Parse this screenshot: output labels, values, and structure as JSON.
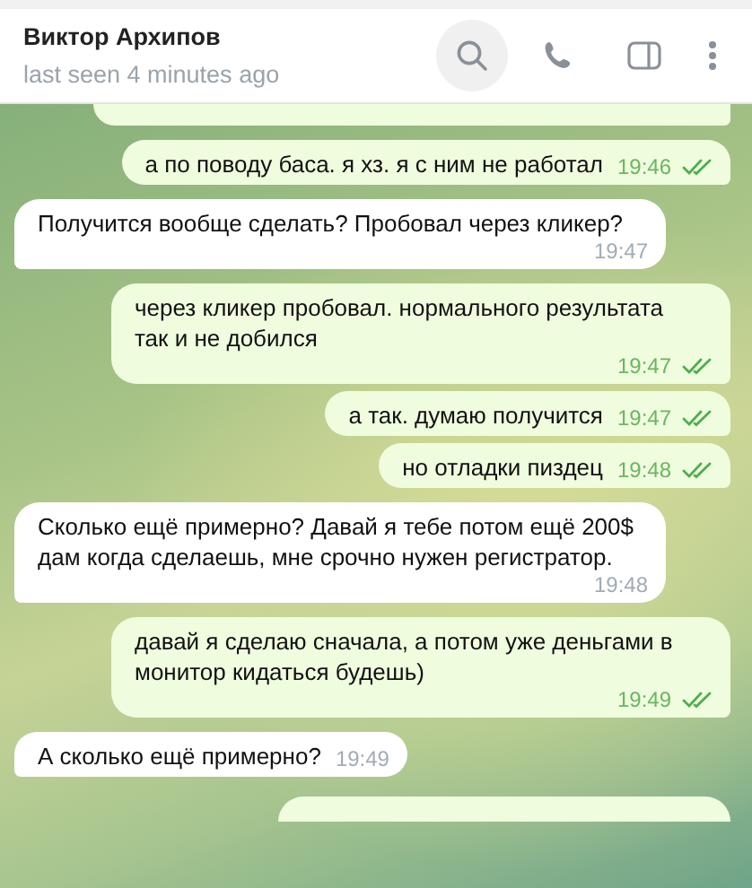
{
  "header": {
    "name": "Виктор Архипов",
    "status": "last seen 4 minutes ago",
    "search_active": true
  },
  "messages": [
    {
      "kind": "out_cut_top"
    },
    {
      "kind": "out",
      "text": "а по поводу баса. я хз. я с ним не работал",
      "time": "19:46",
      "read": true
    },
    {
      "kind": "in",
      "text": "Получится вообще сделать? Пробовал через кликер?",
      "time": "19:47"
    },
    {
      "kind": "out",
      "text": "через кликер пробовал. нормального результата так и не добился",
      "time": "19:47",
      "read": true
    },
    {
      "kind": "out",
      "text": "а так. думаю получится",
      "time": "19:47",
      "read": true
    },
    {
      "kind": "out",
      "text": "но отладки пиздец",
      "time": "19:48",
      "read": true
    },
    {
      "kind": "in",
      "text": "Сколько ещё примерно? Давай я тебе потом ещё 200$ дам когда сделаешь, мне срочно нужен регистратор.",
      "time": "19:48"
    },
    {
      "kind": "out",
      "text": "давай я сделаю сначала, а потом уже деньгами в монитор кидаться будешь)",
      "time": "19:49",
      "read": true
    },
    {
      "kind": "in",
      "text": "А сколько ещё примерно?",
      "time": "19:49"
    },
    {
      "kind": "out_cut_bottom"
    }
  ]
}
